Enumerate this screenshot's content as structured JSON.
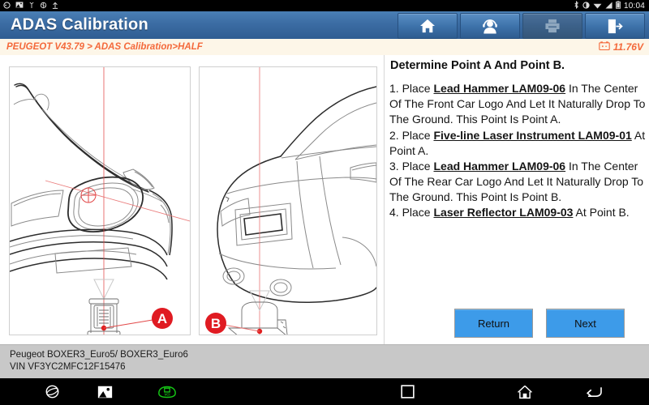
{
  "status_bar": {
    "icons": [
      "bluetooth-icon",
      "brightness-icon",
      "wifi-icon",
      "signal-icon",
      "battery-icon"
    ],
    "time": "10:04"
  },
  "header": {
    "title": "ADAS Calibration",
    "buttons": [
      {
        "name": "home-button",
        "icon": "home-icon",
        "enabled": true
      },
      {
        "name": "support-button",
        "icon": "headset-person-icon",
        "enabled": true
      },
      {
        "name": "print-button",
        "icon": "printer-icon",
        "enabled": false
      },
      {
        "name": "exit-button",
        "icon": "exit-door-icon",
        "enabled": true
      }
    ]
  },
  "breadcrumb": {
    "text": "PEUGEOT V43.79 > ADAS Calibration>HALF",
    "voltage": "11.76V",
    "voltage_icon": "car-battery-icon"
  },
  "illustration": {
    "panel_a": {
      "name": "front-view-diagram",
      "marker": "A",
      "caption": "Front car logo with lead hammer drop point and five-line laser instrument"
    },
    "panel_b": {
      "name": "rear-view-diagram",
      "marker": "B",
      "caption": "Rear car logo with lead hammer drop point and laser reflector"
    }
  },
  "instructions": {
    "heading": "Determine Point A And Point B.",
    "steps": [
      {
        "number": "1. Place ",
        "bold": "Lead Hammer LAM09-06",
        "rest": " In The Center Of The Front Car Logo And Let It Naturally Drop To The Ground. This Point Is Point A."
      },
      {
        "number": "2. Place ",
        "bold": "Five-line Laser Instrument LAM09-01",
        "rest": " At Point A."
      },
      {
        "number": "3. Place ",
        "bold": "Lead Hammer LAM09-06",
        "rest": " In The Center Of The Rear Car Logo And Let It Naturally Drop To The Ground. This Point Is Point B."
      },
      {
        "number": "4. Place ",
        "bold": "Laser Reflector LAM09-03",
        "rest": " At Point B."
      }
    ]
  },
  "footer_buttons": {
    "return_label": "Return",
    "next_label": "Next",
    "accent_color": "#3d9be9"
  },
  "vehicle_info": {
    "model": "Peugeot BOXER3_Euro5/ BOXER3_Euro6",
    "vin": "VIN VF3YC2MFC12F15476"
  },
  "nav_bar": {
    "items": [
      {
        "name": "browser-icon"
      },
      {
        "name": "gallery-icon"
      },
      {
        "name": "vci-connector-icon",
        "color": "#15c415"
      },
      {
        "name": "recent-apps-icon"
      },
      {
        "name": "home-icon"
      },
      {
        "name": "back-icon"
      }
    ]
  }
}
